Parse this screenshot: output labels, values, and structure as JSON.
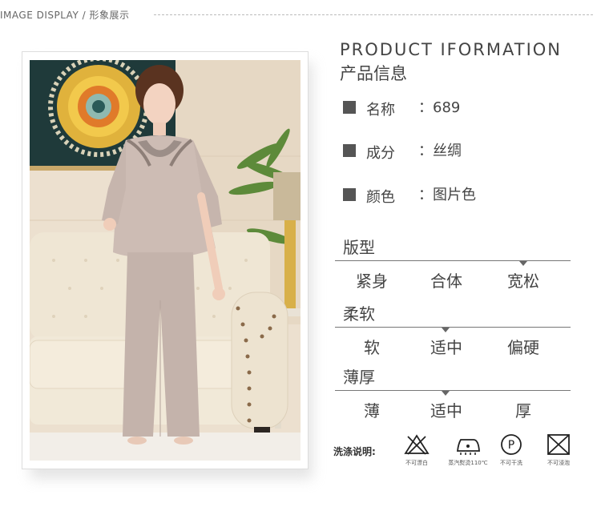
{
  "header": {
    "label": "IMAGE DISPLAY / 形象展示"
  },
  "product": {
    "title_en": "PRODUCT IFORMATION",
    "title_cn": "产品信息",
    "fields": [
      {
        "label": "名称",
        "value": "：689"
      },
      {
        "label": "成分",
        "value": "：丝绸"
      },
      {
        "label": "颜色",
        "value": "：图片色"
      }
    ]
  },
  "scales": [
    {
      "title": "版型",
      "options": [
        "紧身",
        "合体",
        "宽松"
      ],
      "selected_index": 2
    },
    {
      "title": "柔软",
      "options": [
        "软",
        "适中",
        "偏硬"
      ],
      "selected_index": 1
    },
    {
      "title": "薄厚",
      "options": [
        "薄",
        "适中",
        "厚"
      ],
      "selected_index": 1
    }
  ],
  "care": {
    "label": "洗涤说明:",
    "items": [
      {
        "icon": "no-bleach-icon",
        "text": "不可漂白"
      },
      {
        "icon": "iron-icon",
        "text": "蒸汽熨烫110℃"
      },
      {
        "icon": "professional-dryclean-icon",
        "text": "不可干洗"
      },
      {
        "icon": "no-soak-icon",
        "text": "不可浸泡"
      }
    ]
  },
  "colors": {
    "text": "#444444",
    "garment": "#c9b9b2",
    "sofa": "#ece2cf",
    "wall": "#e9dccb"
  }
}
